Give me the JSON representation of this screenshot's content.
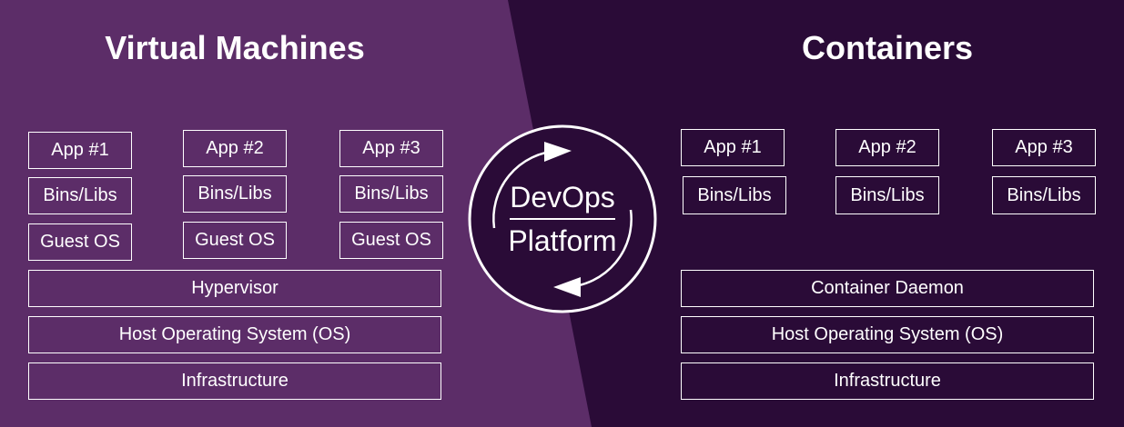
{
  "colors": {
    "left_background": "#5c2d68",
    "right_background": "#2a0b37",
    "border": "#ffffff",
    "text": "#ffffff"
  },
  "virtual_machines": {
    "title": "Virtual Machines",
    "apps": [
      {
        "app": "App #1",
        "bins": "Bins/Libs",
        "os": "Guest OS"
      },
      {
        "app": "App #2",
        "bins": "Bins/Libs",
        "os": "Guest OS"
      },
      {
        "app": "App #3",
        "bins": "Bins/Libs",
        "os": "Guest OS"
      }
    ],
    "layers": [
      "Hypervisor",
      "Host Operating System (OS)",
      "Infrastructure"
    ]
  },
  "containers": {
    "title": "Containers",
    "apps": [
      {
        "app": "App #1",
        "bins": "Bins/Libs"
      },
      {
        "app": "App #2",
        "bins": "Bins/Libs"
      },
      {
        "app": "App #3",
        "bins": "Bins/Libs"
      }
    ],
    "layers": [
      "Container Daemon",
      "Host Operating System (OS)",
      "Infrastructure"
    ]
  },
  "logo": {
    "line1": "DevOps",
    "line2": "Platform",
    "icon": "cycle-arrows-icon"
  }
}
